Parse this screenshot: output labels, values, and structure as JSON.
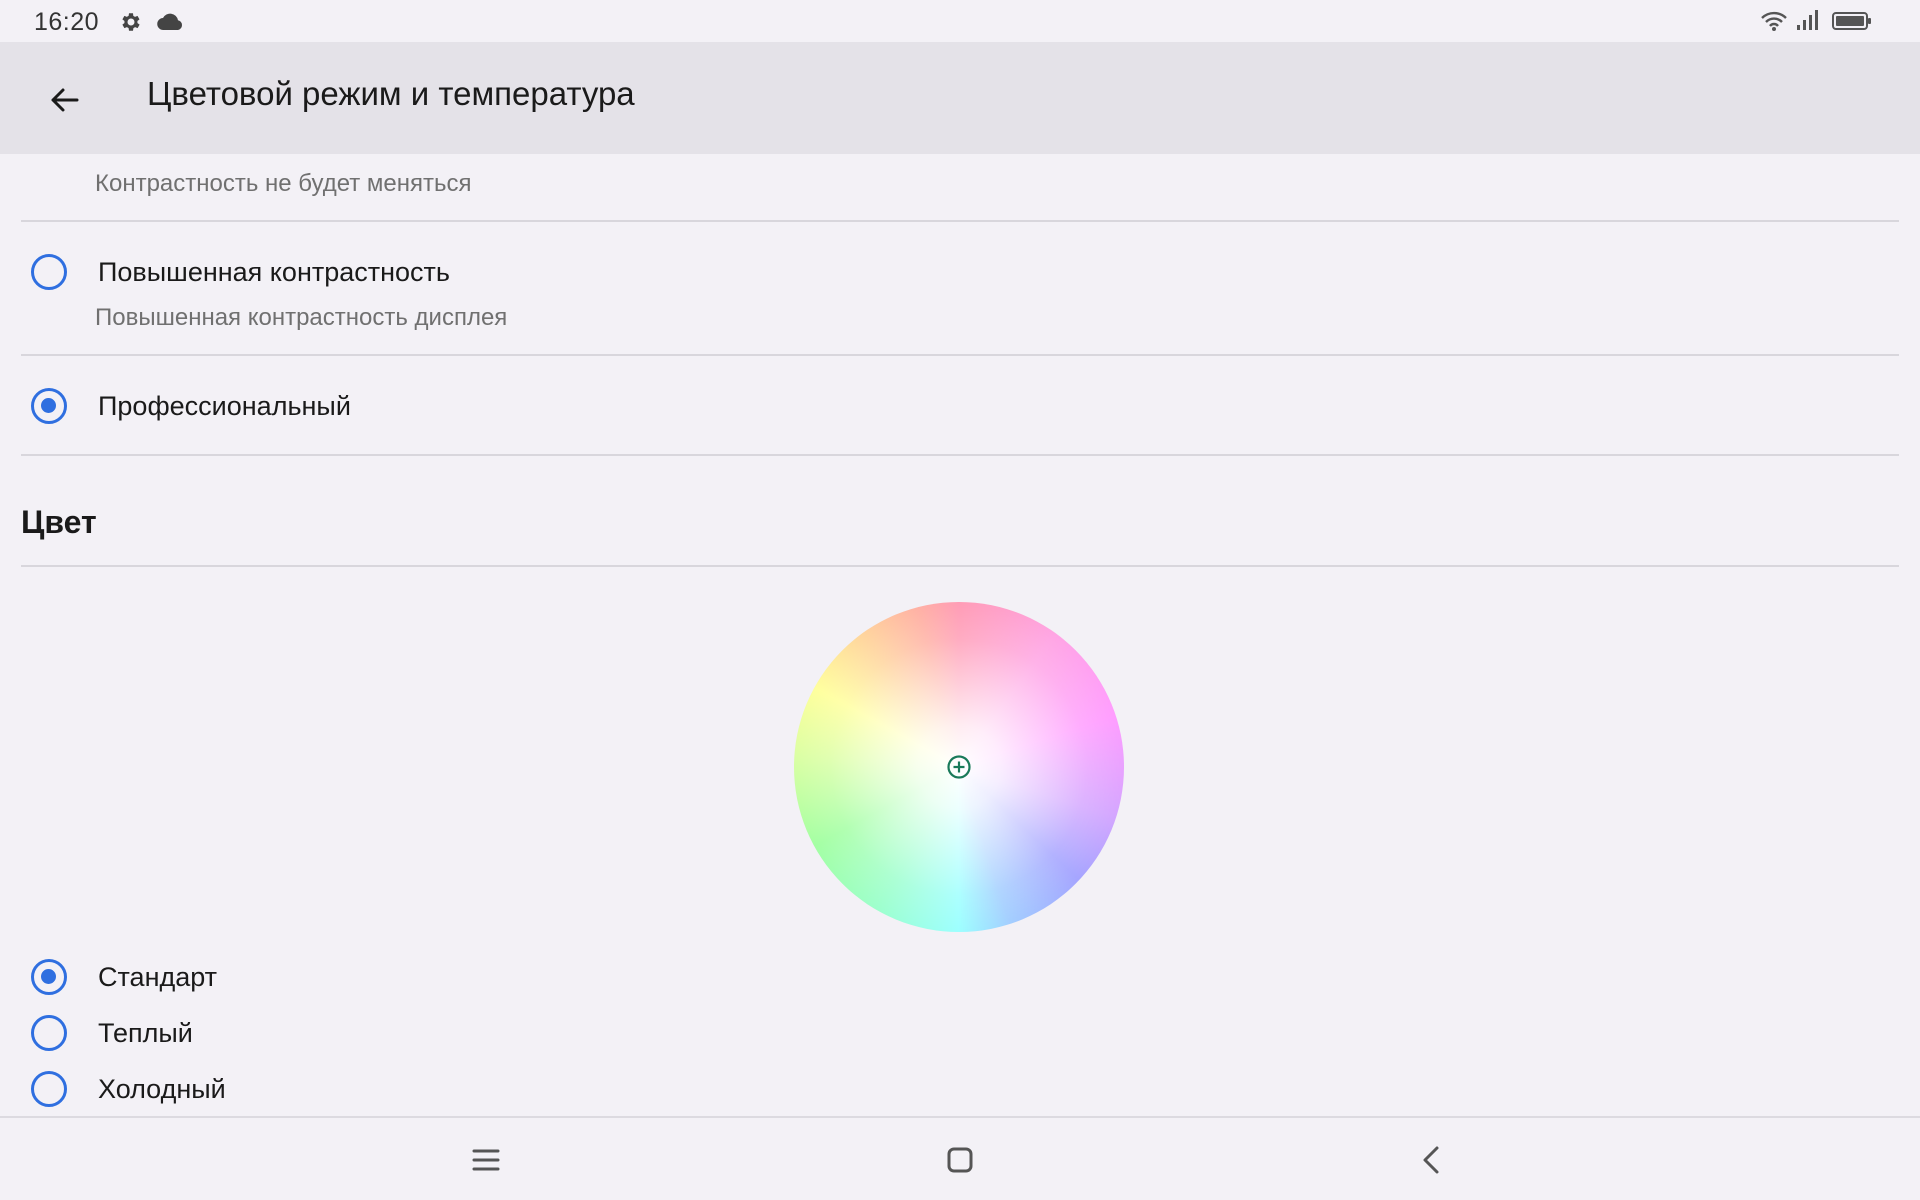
{
  "status_bar": {
    "time": "16:20",
    "icons_left": [
      "gear-icon",
      "cloud-icon"
    ],
    "icons_right": [
      "wifi-icon",
      "signal-icon",
      "battery-icon"
    ]
  },
  "app_bar": {
    "title": "Цветовой режим и температура",
    "back_icon": "arrow-left-icon"
  },
  "contrast_options": [
    {
      "title": "",
      "subtitle": "Контрастность не будет меняться",
      "checked": false
    },
    {
      "title": "Повышенная контрастность",
      "subtitle": "Повышенная контрастность дисплея",
      "checked": false
    },
    {
      "title": "Профессиональный",
      "subtitle": "",
      "checked": true
    }
  ],
  "color_section": {
    "header": "Цвет",
    "wheel_marker_icon": "plus-circle-icon",
    "temperature_options": [
      {
        "label": "Стандарт",
        "checked": true
      },
      {
        "label": "Теплый",
        "checked": false
      },
      {
        "label": "Холодный",
        "checked": false
      }
    ]
  },
  "nav_bar": {
    "icons": [
      "menu-icon",
      "home-icon",
      "back-icon"
    ]
  },
  "colors": {
    "accent": "#2f6fe0",
    "app_bar_bg": "#e4e2e8",
    "background": "#f3f1f6",
    "marker": "#1a7a5a"
  }
}
